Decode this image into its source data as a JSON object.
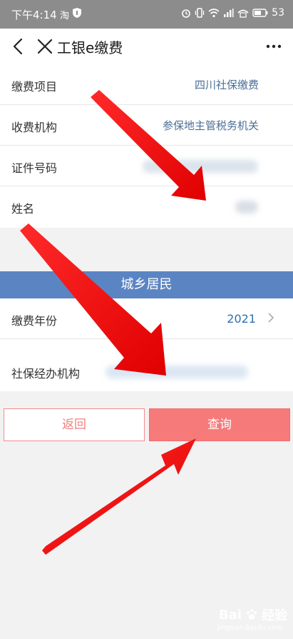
{
  "status_bar": {
    "time": "下午4:14",
    "app_icon": "淘",
    "battery": "53",
    "icons": [
      "shield-icon",
      "alarm-icon",
      "vibrate-icon",
      "wifi-icon",
      "signal-icon",
      "hd-icon",
      "battery-icon"
    ]
  },
  "header": {
    "title": "工银e缴费",
    "icons": [
      "back-arrow-icon",
      "close-icon",
      "more-icon"
    ]
  },
  "form": {
    "rows": [
      {
        "label": "缴费项目",
        "value": "四川社保缴费"
      },
      {
        "label": "收费机构",
        "value": "参保地主管税务机关"
      },
      {
        "label": "证件号码",
        "value": ""
      },
      {
        "label": "姓名",
        "value": ""
      }
    ]
  },
  "section": {
    "title": "城乡居民",
    "year_label": "缴费年份",
    "year_value": "2021",
    "agency_label": "社保经办机构",
    "agency_value": ""
  },
  "buttons": {
    "back": "返回",
    "query": "查询"
  },
  "watermark": {
    "brand": "Bai",
    "suffix": "经验",
    "sub": "jingyan.baidu.com"
  },
  "colors": {
    "status_bar": "#8c8c8c",
    "section_header": "#5b84c3",
    "query_button": "#f77a7b",
    "back_button_border": "#f28c8c",
    "value_text": "#4a6f96",
    "annotation_arrow": "#ff0000"
  }
}
